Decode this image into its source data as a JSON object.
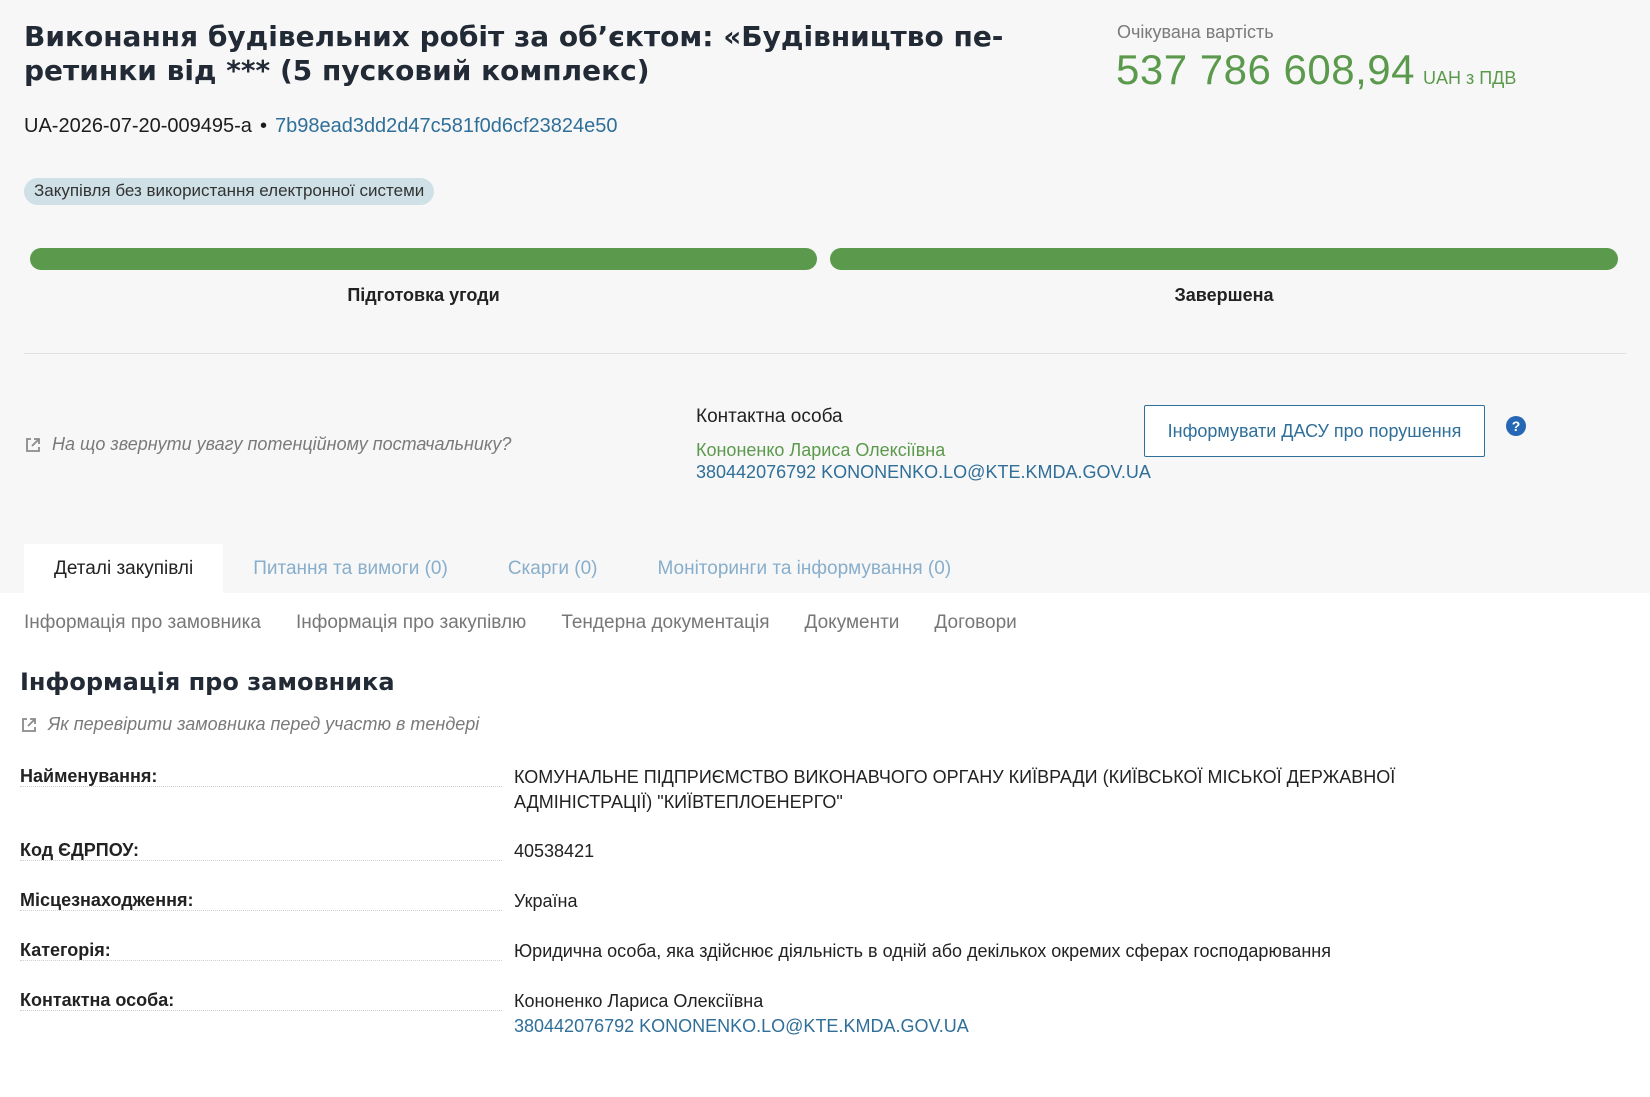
{
  "header": {
    "title_line1": "Виконання будівельних робіт за об’єктом: «Будівництво пе-",
    "title_line2": "ретинки від *** (5 пусковий комплекс)",
    "price_label": "Очікувана вартість",
    "price_value": "537 786 608,94",
    "price_unit": "UAH з ПДВ",
    "tender_id": "UA-2026-07-20-009495-a",
    "separator": "•",
    "hash": "7b98ead3dd2d47c581f0d6cf23824e50",
    "badge": "Закупівля без використання електронної системи"
  },
  "progress": {
    "stages": [
      {
        "label": "Підготовка угоди",
        "complete": true
      },
      {
        "label": "Завершена",
        "complete": true
      }
    ],
    "bar_color": "#5b9a4c"
  },
  "info": {
    "hint_text": "На що звернути увагу потенційному постачальнику?",
    "contact_label": "Контактна особа",
    "contact_name": "Кононенко Лариса Олексіївна",
    "contact_phone": "380442076792",
    "contact_email": "KONONENKO.LO@KTE.KMDA.GOV.UA",
    "dasu_button": "Інформувати ДАСУ про порушення",
    "help_icon": "?"
  },
  "tabs": [
    {
      "label": "Деталі закупівлі",
      "active": true
    },
    {
      "label": "Питання та вимоги (0)",
      "active": false
    },
    {
      "label": "Скарги (0)",
      "active": false
    },
    {
      "label": "Моніторинги та інформування (0)",
      "active": false
    }
  ],
  "subnav": [
    "Інформація про замовника",
    "Інформація про закупівлю",
    "Тендерна документація",
    "Документи",
    "Договори"
  ],
  "customer": {
    "section_title": "Інформація про замовника",
    "check_hint": "Як перевірити замовника перед участю в тендері",
    "rows": [
      {
        "label": "Найменування:",
        "value": "КОМУНАЛЬНЕ ПІДПРИЄМСТВО ВИКОНАВЧОГО ОРГАНУ КИЇВРАДИ (КИЇВСЬКОЇ МІСЬКОЇ ДЕРЖАВНОЇ АДМІНІСТРАЦІЇ) \"КИЇВТЕПЛОЕНЕРГО\""
      },
      {
        "label": "Код ЄДРПОУ:",
        "value": "40538421"
      },
      {
        "label": "Місцезнаходження:",
        "value": "Україна"
      },
      {
        "label": "Категорія:",
        "value": "Юридична особа, яка здійснює діяльність в одній або декількох окремих сферах господарювання"
      },
      {
        "label": "Контактна особа:",
        "value": "Кононенко Лариса Олексіївна",
        "link": "380442076792 KONONENKO.LO@KTE.KMDA.GOV.UA"
      }
    ]
  },
  "colors": {
    "accent_green": "#5b9a4c",
    "link_blue": "#2f6f99",
    "badge_bg": "#cfe0e6"
  }
}
